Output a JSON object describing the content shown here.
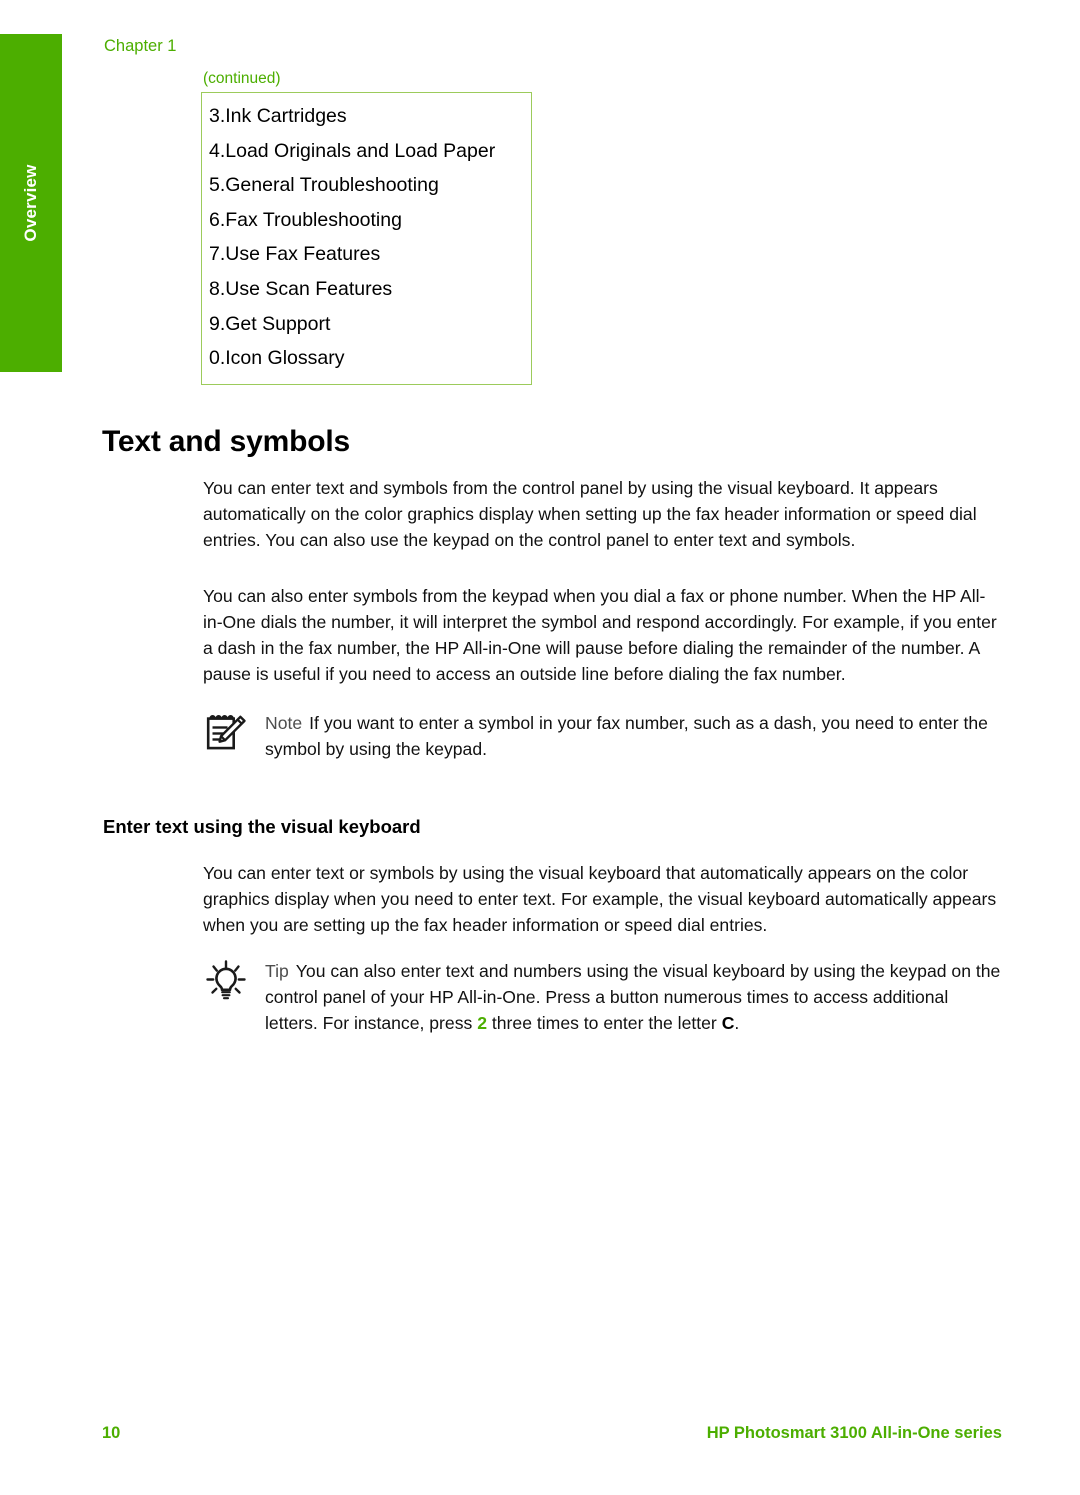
{
  "side_tab": {
    "label": "Overview"
  },
  "header": {
    "chapter": "Chapter 1"
  },
  "toc_table": {
    "continued_label": "(continued)",
    "rows": [
      "3.Ink Cartridges",
      "4.Load Originals and Load Paper",
      "5.General Troubleshooting",
      "6.Fax Troubleshooting",
      "7.Use Fax Features",
      "8.Use Scan Features",
      "9.Get Support",
      "0.Icon Glossary"
    ]
  },
  "section": {
    "title": "Text and symbols",
    "paragraph_1": "You can enter text and symbols from the control panel by using the visual keyboard. It appears automatically on the color graphics display when setting up the fax header information or speed dial entries. You can also use the keypad on the control panel to enter text and symbols.",
    "paragraph_2": "You can also enter symbols from the keypad when you dial a fax or phone number. When the HP All-in-One dials the number, it will interpret the symbol and respond accordingly. For example, if you enter a dash in the fax number, the HP All-in-One will pause before dialing the remainder of the number. A pause is useful if you need to access an outside line before dialing the fax number."
  },
  "note_callout": {
    "label": "Note",
    "text": "If you want to enter a symbol in your fax number, such as a dash, you need to enter the symbol by using the keypad."
  },
  "subsection": {
    "title": "Enter text using the visual keyboard",
    "paragraph_1": "You can enter text or symbols by using the visual keyboard that automatically appears on the color graphics display when you need to enter text. For example, the visual keyboard automatically appears when you are setting up the fax header information or speed dial entries."
  },
  "tip_callout": {
    "label": "Tip",
    "text_part_1": "You can also enter text and numbers using the visual keyboard by using the keypad on the control panel of your HP All-in-One. Press a button numerous times to access additional letters. For instance, press ",
    "highlight_key": "2",
    "text_part_2": " three times to enter the letter ",
    "highlight_letter": "C",
    "text_part_3": "."
  },
  "footer": {
    "page_number": "10",
    "product": "HP Photosmart 3100 All-in-One series"
  },
  "colors": {
    "brand_green": "#4CAE00",
    "table_border_green": "#9CCB5B",
    "text_black": "#111111",
    "label_gray": "#4d4d4d"
  },
  "icons": {
    "note": "notepad-pencil-icon",
    "tip": "lightbulb-icon"
  }
}
